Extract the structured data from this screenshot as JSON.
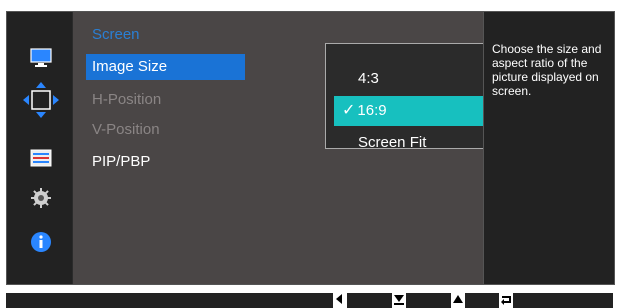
{
  "sidebar": {
    "icons": [
      "monitor-icon",
      "position-arrows-icon",
      "settings-sliders-icon",
      "gear-icon",
      "info-icon"
    ]
  },
  "menu": {
    "title": "Screen",
    "items": [
      {
        "label": "Image Size",
        "state": "active"
      },
      {
        "label": "H-Position",
        "state": "disabled"
      },
      {
        "label": "V-Position",
        "state": "disabled"
      },
      {
        "label": "PIP/PBP",
        "state": "normal"
      }
    ]
  },
  "submenu": {
    "options": [
      {
        "label": "4:3",
        "selected": false
      },
      {
        "label": "16:9",
        "selected": true
      },
      {
        "label": "Screen Fit",
        "selected": false
      }
    ]
  },
  "help": {
    "text": "Choose the size and aspect ratio of the picture displayed on screen."
  },
  "bottom_keys": [
    "left-arrow-key-icon",
    "down-arrow-key-icon",
    "up-arrow-key-icon",
    "return-key-icon"
  ],
  "colors": {
    "accent_blue": "#1a73d6",
    "title_blue": "#2a7fd4",
    "selected_teal": "#17c0bf",
    "panel_bg": "#4a4646",
    "osd_bg": "#222222"
  }
}
